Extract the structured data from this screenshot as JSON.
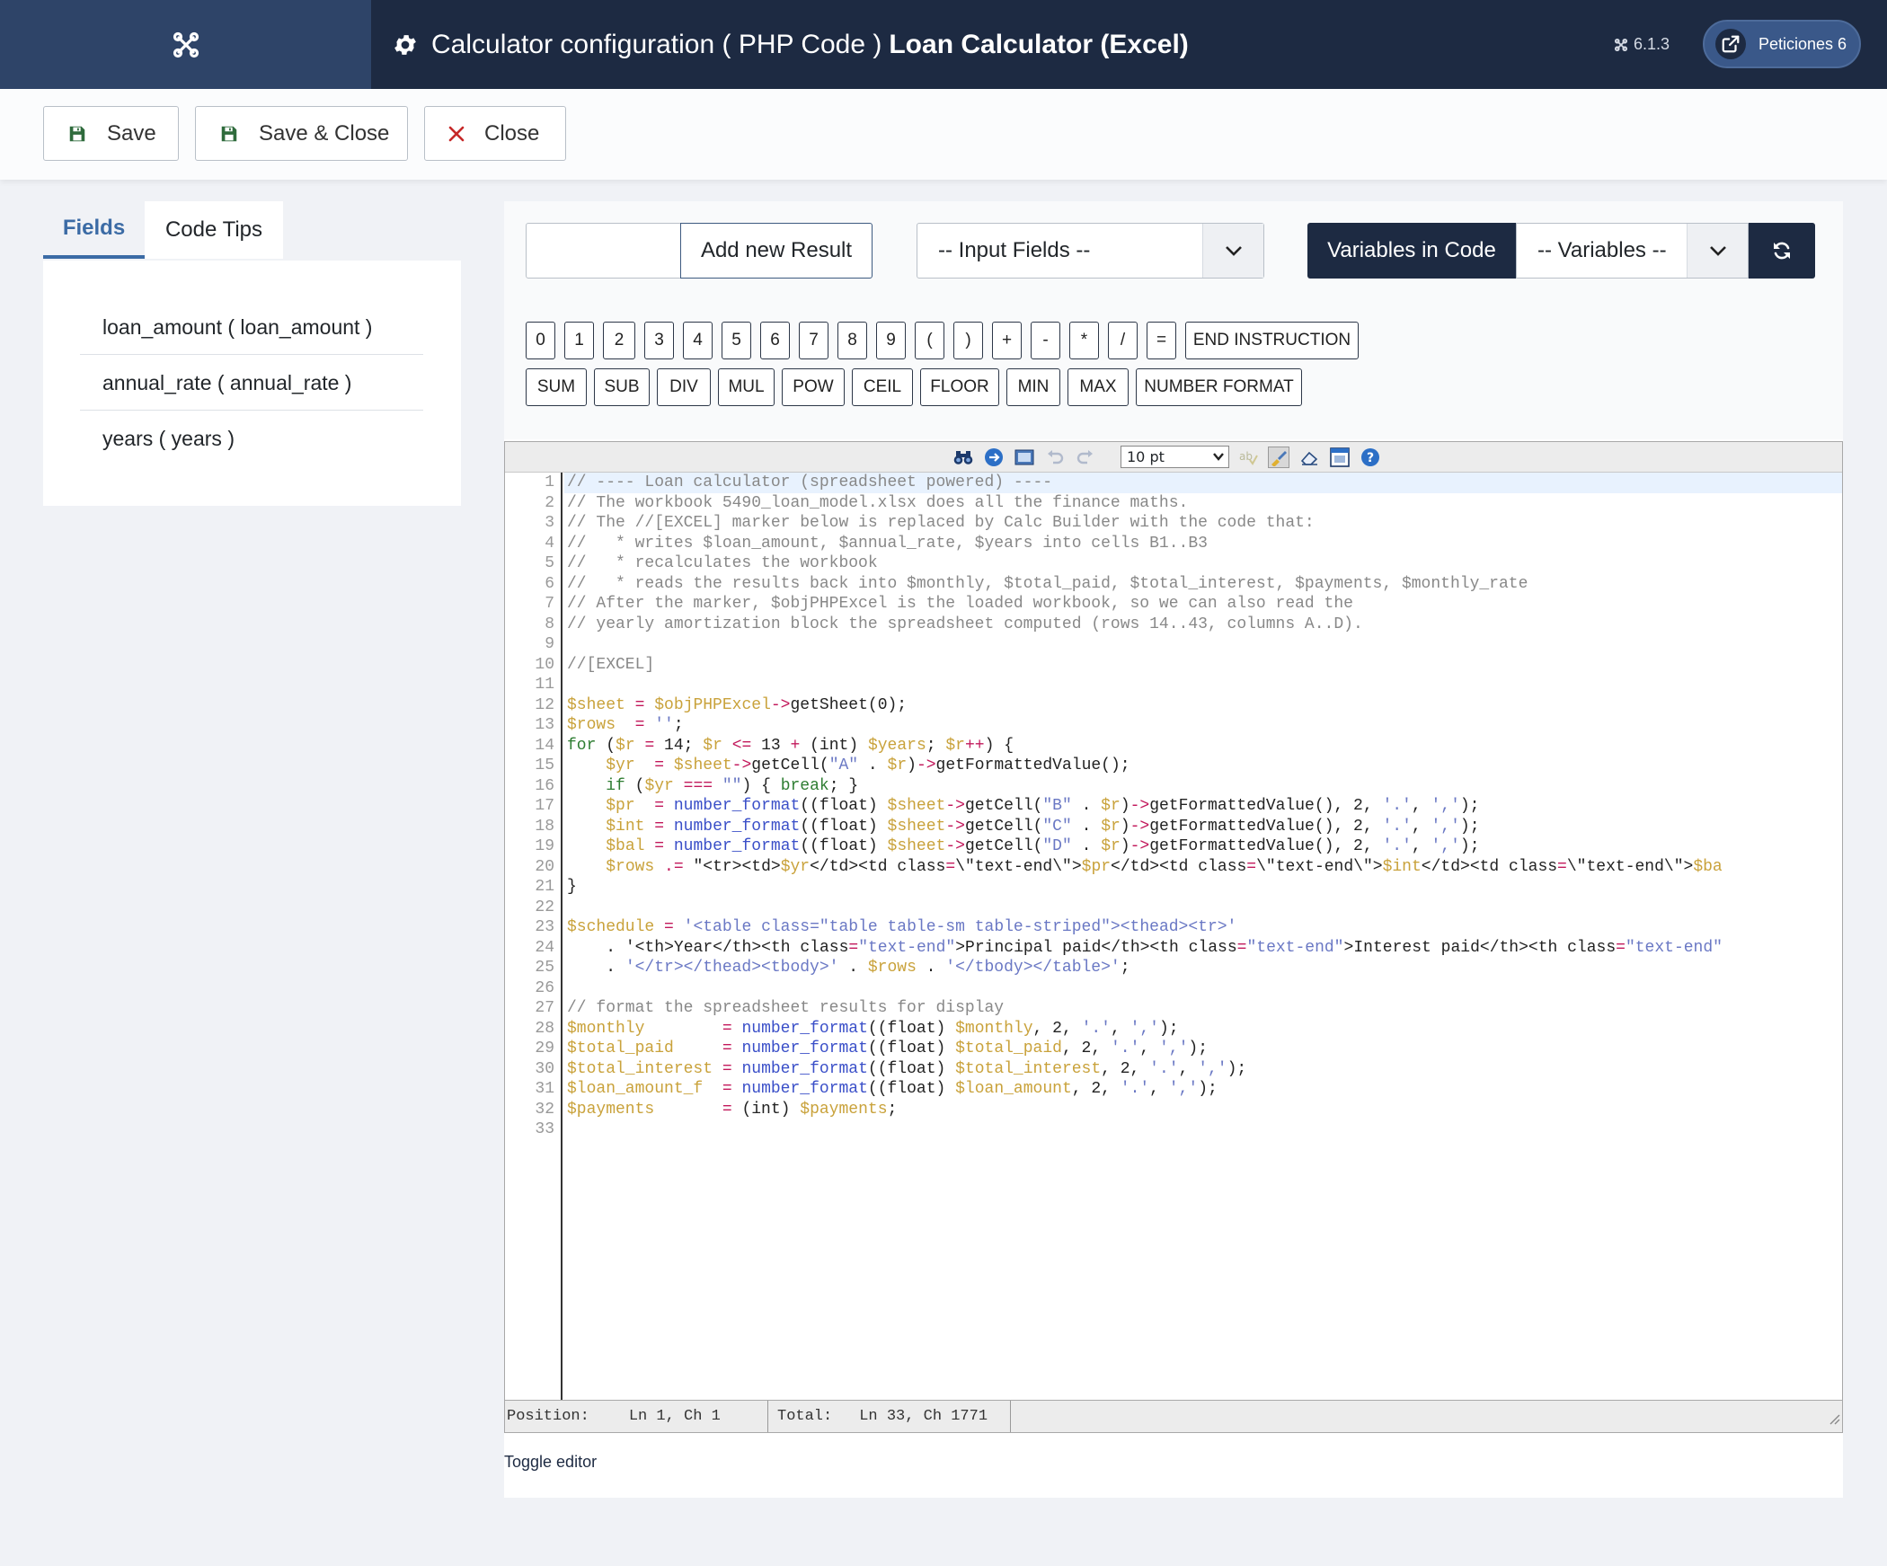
{
  "header": {
    "title_prefix": "Calculator configuration ( PHP Code )",
    "title_bold": "Loan Calculator (Excel)",
    "version": "6.1.3",
    "peticiones_label": "Peticiones 6"
  },
  "toolbar": {
    "save_label": "Save",
    "save_close_label": "Save & Close",
    "close_label": "Close"
  },
  "left": {
    "tabs": [
      "Fields",
      "Code Tips"
    ],
    "fields": [
      "loan_amount ( loan_amount )",
      "annual_rate ( annual_rate )",
      "years ( years )"
    ]
  },
  "controls": {
    "result_input_value": "",
    "add_result_label": "Add new Result",
    "input_fields_selected": "-- Input Fields --",
    "variables_in_code_label": "Variables in Code",
    "variables_selected": "-- Variables --"
  },
  "keys_row1": [
    "0",
    "1",
    "2",
    "3",
    "4",
    "5",
    "6",
    "7",
    "8",
    "9",
    "(",
    ")",
    "+",
    "-",
    "*",
    "/",
    "=",
    "END INSTRUCTION"
  ],
  "keys_row2": [
    "SUM",
    "SUB",
    "DIV",
    "MUL",
    "POW",
    "CEIL",
    "FLOOR",
    "MIN",
    "MAX",
    "NUMBER FORMAT"
  ],
  "editor": {
    "font_size": "10 pt",
    "code_lines": [
      "// ---- Loan calculator (spreadsheet powered) ----",
      "// The workbook 5490_loan_model.xlsx does all the finance maths.",
      "// The //[EXCEL] marker below is replaced by Calc Builder with the code that:",
      "//   * writes $loan_amount, $annual_rate, $years into cells B1..B3",
      "//   * recalculates the workbook",
      "//   * reads the results back into $monthly, $total_paid, $total_interest, $payments, $monthly_rate",
      "// After the marker, $objPHPExcel is the loaded workbook, so we can also read the",
      "// yearly amortization block the spreadsheet computed (rows 14..43, columns A..D).",
      "",
      "//[EXCEL]",
      "",
      "$sheet = $objPHPExcel->getSheet(0);",
      "$rows  = '';",
      "for ($r = 14; $r <= 13 + (int) $years; $r++) {",
      "    $yr  = $sheet->getCell(\"A\" . $r)->getFormattedValue();",
      "    if ($yr === \"\") { break; }",
      "    $pr  = number_format((float) $sheet->getCell(\"B\" . $r)->getFormattedValue(), 2, '.', ',');",
      "    $int = number_format((float) $sheet->getCell(\"C\" . $r)->getFormattedValue(), 2, '.', ',');",
      "    $bal = number_format((float) $sheet->getCell(\"D\" . $r)->getFormattedValue(), 2, '.', ',');",
      "    $rows .= \"<tr><td>$yr</td><td class=\\\"text-end\\\">$pr</td><td class=\\\"text-end\\\">$int</td><td class=\\\"text-end\\\">$ba",
      "}",
      "",
      "$schedule = '<table class=\"table table-sm table-striped\"><thead><tr>'",
      "    . '<th>Year</th><th class=\"text-end\">Principal paid</th><th class=\"text-end\">Interest paid</th><th class=\"text-end\"",
      "    . '</tr></thead><tbody>' . $rows . '</tbody></table>';",
      "",
      "// format the spreadsheet results for display",
      "$monthly        = number_format((float) $monthly, 2, '.', ',');",
      "$total_paid     = number_format((float) $total_paid, 2, '.', ',');",
      "$total_interest = number_format((float) $total_interest, 2, '.', ',');",
      "$loan_amount_f  = number_format((float) $loan_amount, 2, '.', ',');",
      "$payments       = (int) $payments;",
      ""
    ],
    "status_position_label": "Position:",
    "status_position_value": "Ln 1, Ch 1",
    "status_total_label": "Total:",
    "status_total_value": "Ln 33, Ch 1771",
    "toggle_label": "Toggle editor"
  }
}
